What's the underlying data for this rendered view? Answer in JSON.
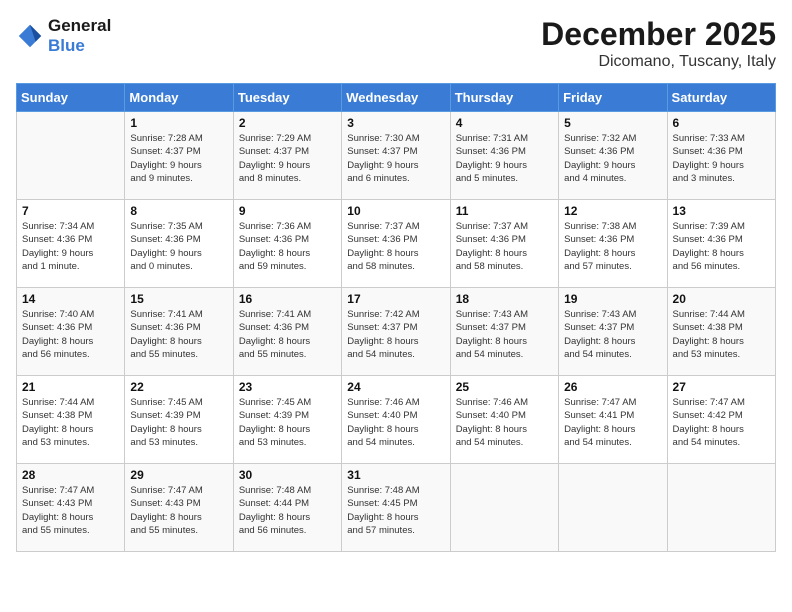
{
  "header": {
    "logo_line1": "General",
    "logo_line2": "Blue",
    "month": "December 2025",
    "location": "Dicomano, Tuscany, Italy"
  },
  "weekdays": [
    "Sunday",
    "Monday",
    "Tuesday",
    "Wednesday",
    "Thursday",
    "Friday",
    "Saturday"
  ],
  "weeks": [
    [
      {
        "day": "",
        "info": ""
      },
      {
        "day": "1",
        "info": "Sunrise: 7:28 AM\nSunset: 4:37 PM\nDaylight: 9 hours\nand 9 minutes."
      },
      {
        "day": "2",
        "info": "Sunrise: 7:29 AM\nSunset: 4:37 PM\nDaylight: 9 hours\nand 8 minutes."
      },
      {
        "day": "3",
        "info": "Sunrise: 7:30 AM\nSunset: 4:37 PM\nDaylight: 9 hours\nand 6 minutes."
      },
      {
        "day": "4",
        "info": "Sunrise: 7:31 AM\nSunset: 4:36 PM\nDaylight: 9 hours\nand 5 minutes."
      },
      {
        "day": "5",
        "info": "Sunrise: 7:32 AM\nSunset: 4:36 PM\nDaylight: 9 hours\nand 4 minutes."
      },
      {
        "day": "6",
        "info": "Sunrise: 7:33 AM\nSunset: 4:36 PM\nDaylight: 9 hours\nand 3 minutes."
      }
    ],
    [
      {
        "day": "7",
        "info": "Sunrise: 7:34 AM\nSunset: 4:36 PM\nDaylight: 9 hours\nand 1 minute."
      },
      {
        "day": "8",
        "info": "Sunrise: 7:35 AM\nSunset: 4:36 PM\nDaylight: 9 hours\nand 0 minutes."
      },
      {
        "day": "9",
        "info": "Sunrise: 7:36 AM\nSunset: 4:36 PM\nDaylight: 8 hours\nand 59 minutes."
      },
      {
        "day": "10",
        "info": "Sunrise: 7:37 AM\nSunset: 4:36 PM\nDaylight: 8 hours\nand 58 minutes."
      },
      {
        "day": "11",
        "info": "Sunrise: 7:37 AM\nSunset: 4:36 PM\nDaylight: 8 hours\nand 58 minutes."
      },
      {
        "day": "12",
        "info": "Sunrise: 7:38 AM\nSunset: 4:36 PM\nDaylight: 8 hours\nand 57 minutes."
      },
      {
        "day": "13",
        "info": "Sunrise: 7:39 AM\nSunset: 4:36 PM\nDaylight: 8 hours\nand 56 minutes."
      }
    ],
    [
      {
        "day": "14",
        "info": "Sunrise: 7:40 AM\nSunset: 4:36 PM\nDaylight: 8 hours\nand 56 minutes."
      },
      {
        "day": "15",
        "info": "Sunrise: 7:41 AM\nSunset: 4:36 PM\nDaylight: 8 hours\nand 55 minutes."
      },
      {
        "day": "16",
        "info": "Sunrise: 7:41 AM\nSunset: 4:36 PM\nDaylight: 8 hours\nand 55 minutes."
      },
      {
        "day": "17",
        "info": "Sunrise: 7:42 AM\nSunset: 4:37 PM\nDaylight: 8 hours\nand 54 minutes."
      },
      {
        "day": "18",
        "info": "Sunrise: 7:43 AM\nSunset: 4:37 PM\nDaylight: 8 hours\nand 54 minutes."
      },
      {
        "day": "19",
        "info": "Sunrise: 7:43 AM\nSunset: 4:37 PM\nDaylight: 8 hours\nand 54 minutes."
      },
      {
        "day": "20",
        "info": "Sunrise: 7:44 AM\nSunset: 4:38 PM\nDaylight: 8 hours\nand 53 minutes."
      }
    ],
    [
      {
        "day": "21",
        "info": "Sunrise: 7:44 AM\nSunset: 4:38 PM\nDaylight: 8 hours\nand 53 minutes."
      },
      {
        "day": "22",
        "info": "Sunrise: 7:45 AM\nSunset: 4:39 PM\nDaylight: 8 hours\nand 53 minutes."
      },
      {
        "day": "23",
        "info": "Sunrise: 7:45 AM\nSunset: 4:39 PM\nDaylight: 8 hours\nand 53 minutes."
      },
      {
        "day": "24",
        "info": "Sunrise: 7:46 AM\nSunset: 4:40 PM\nDaylight: 8 hours\nand 54 minutes."
      },
      {
        "day": "25",
        "info": "Sunrise: 7:46 AM\nSunset: 4:40 PM\nDaylight: 8 hours\nand 54 minutes."
      },
      {
        "day": "26",
        "info": "Sunrise: 7:47 AM\nSunset: 4:41 PM\nDaylight: 8 hours\nand 54 minutes."
      },
      {
        "day": "27",
        "info": "Sunrise: 7:47 AM\nSunset: 4:42 PM\nDaylight: 8 hours\nand 54 minutes."
      }
    ],
    [
      {
        "day": "28",
        "info": "Sunrise: 7:47 AM\nSunset: 4:43 PM\nDaylight: 8 hours\nand 55 minutes."
      },
      {
        "day": "29",
        "info": "Sunrise: 7:47 AM\nSunset: 4:43 PM\nDaylight: 8 hours\nand 55 minutes."
      },
      {
        "day": "30",
        "info": "Sunrise: 7:48 AM\nSunset: 4:44 PM\nDaylight: 8 hours\nand 56 minutes."
      },
      {
        "day": "31",
        "info": "Sunrise: 7:48 AM\nSunset: 4:45 PM\nDaylight: 8 hours\nand 57 minutes."
      },
      {
        "day": "",
        "info": ""
      },
      {
        "day": "",
        "info": ""
      },
      {
        "day": "",
        "info": ""
      }
    ]
  ]
}
